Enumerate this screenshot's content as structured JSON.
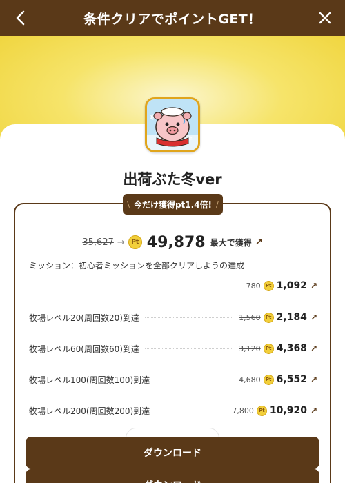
{
  "header": {
    "title": "条件クリアでポイントGET！"
  },
  "app": {
    "name": "出荷ぶた冬ver"
  },
  "campaign": {
    "ribbon_text": "今だけ獲得pt1.4倍!",
    "ribbon_slash_left": "\\",
    "ribbon_slash_right": "/",
    "old_total": "35,627",
    "arrow": "→",
    "pt_icon": "Pt",
    "new_total": "49,878",
    "suffix": "最大で獲得",
    "diag_arrow": "↗"
  },
  "mission": {
    "title": "ミッション：初心者ミッションを全部クリアしようの達成",
    "rows": [
      {
        "label": "",
        "old": "780",
        "value": "1,092"
      },
      {
        "label": "牧場レベル20(周回数20)到達",
        "old": "1,560",
        "value": "2,184"
      },
      {
        "label": "牧場レベル60(周回数60)到達",
        "old": "3,120",
        "value": "4,368"
      },
      {
        "label": "牧場レベル100(周回数100)到達",
        "old": "4,680",
        "value": "6,552"
      },
      {
        "label": "牧場レベル200(周回数200)到達",
        "old": "7,800",
        "value": "10,920"
      }
    ]
  },
  "buttons": {
    "download_label": "ダウンロード",
    "download_label_2": "ダウンロード"
  },
  "colors": {
    "brand_brown": "#5a3918",
    "hero_yellow": "#efd338",
    "coin_gold": "#f2cf3a"
  },
  "icons": {
    "back": "back-arrow-icon",
    "close": "close-icon",
    "coin": "point-coin-icon",
    "diag": "arrow-up-right-icon"
  }
}
